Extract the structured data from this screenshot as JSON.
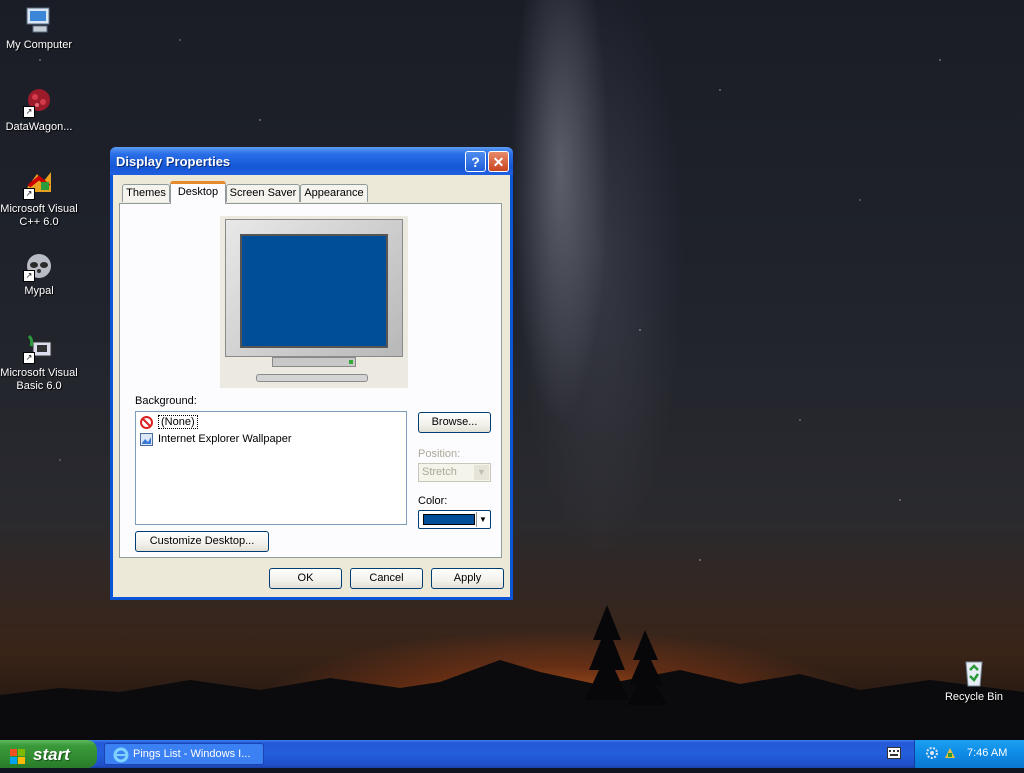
{
  "desktop": {
    "icons": [
      {
        "label": "My Computer"
      },
      {
        "label": "DataWagon..."
      },
      {
        "label": "Microsoft Visual C++ 6.0"
      },
      {
        "label": "Mypal"
      },
      {
        "label": "Microsoft Visual Basic 6.0"
      },
      {
        "label": "Recycle Bin"
      }
    ]
  },
  "dialog": {
    "title": "Display Properties",
    "help_glyph": "?",
    "close_glyph": "✕",
    "tabs": [
      "Themes",
      "Desktop",
      "Screen Saver",
      "Appearance"
    ],
    "active_tab": "Desktop",
    "background_label": "Background:",
    "background_items": [
      "(None)",
      "Internet Explorer Wallpaper"
    ],
    "selected_background": "(None)",
    "browse_label": "Browse...",
    "position_label": "Position:",
    "position_value": "Stretch",
    "color_label": "Color:",
    "color_value": "#004e98",
    "customize_label": "Customize Desktop...",
    "ok_label": "OK",
    "cancel_label": "Cancel",
    "apply_label": "Apply"
  },
  "taskbar": {
    "start_label": "start",
    "task_item": "Pings List - Windows I...",
    "clock": "7:46 AM"
  },
  "colors": {
    "titlebar": "#1557d6",
    "taskbar": "#245edb",
    "start": "#3a9a3a",
    "monitor_screen": "#004e98",
    "dialog_face": "#ece9d8"
  }
}
